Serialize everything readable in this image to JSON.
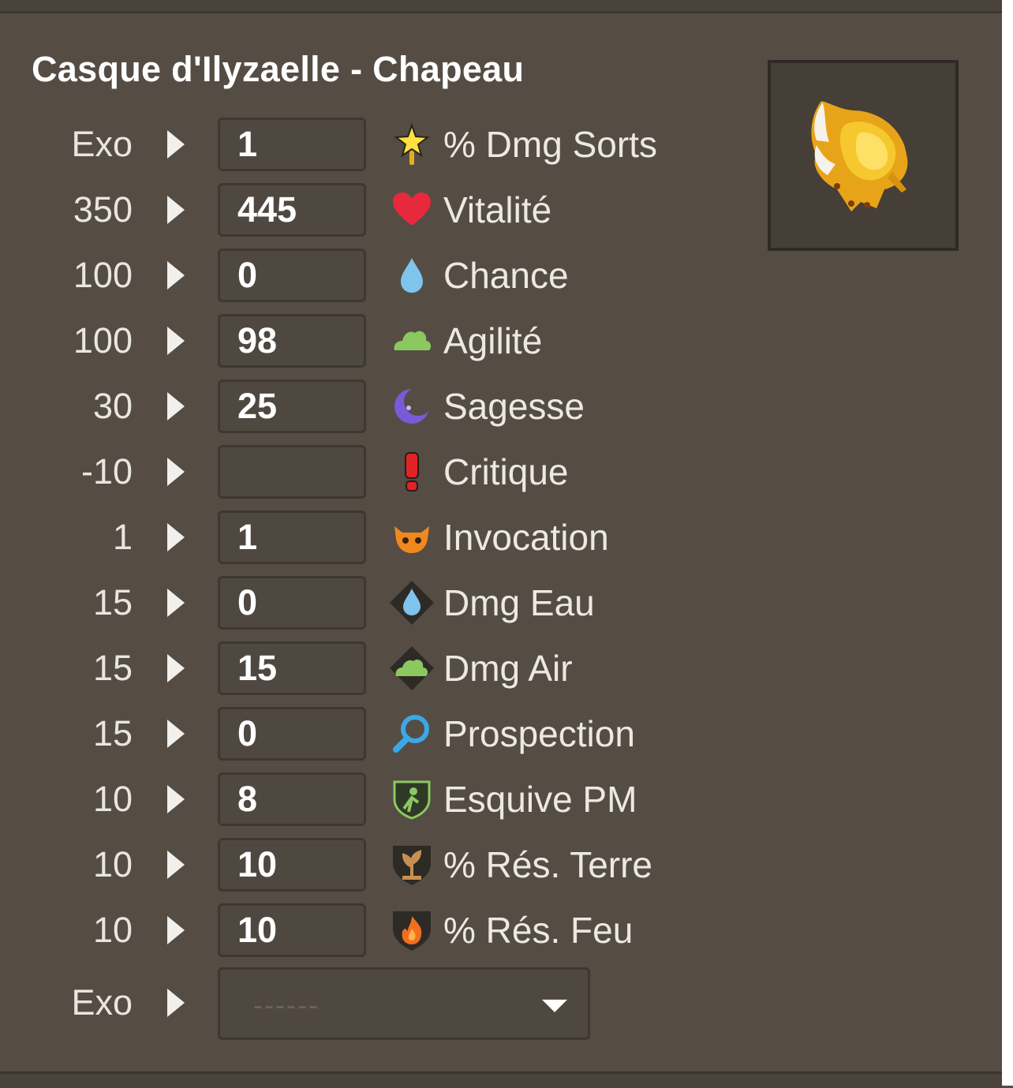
{
  "item": {
    "title": "Casque d'Ilyzaelle - Chapeau",
    "image_icon": "golden-winged-helmet-icon"
  },
  "rows": [
    {
      "base": "Exo",
      "value": "1",
      "label": "% Dmg Sorts",
      "icon": "star-wand-icon"
    },
    {
      "base": "350",
      "value": "445",
      "label": "Vitalité",
      "icon": "heart-icon"
    },
    {
      "base": "100",
      "value": "0",
      "label": "Chance",
      "icon": "water-drop-icon"
    },
    {
      "base": "100",
      "value": "98",
      "label": "Agilité",
      "icon": "cloud-icon"
    },
    {
      "base": "30",
      "value": "25",
      "label": "Sagesse",
      "icon": "moon-icon"
    },
    {
      "base": "-10",
      "value": "",
      "label": "Critique",
      "icon": "exclamation-icon"
    },
    {
      "base": "1",
      "value": "1",
      "label": "Invocation",
      "icon": "monster-head-icon"
    },
    {
      "base": "15",
      "value": "0",
      "label": "Dmg Eau",
      "icon": "water-damage-icon"
    },
    {
      "base": "15",
      "value": "15",
      "label": "Dmg Air",
      "icon": "air-damage-icon"
    },
    {
      "base": "15",
      "value": "0",
      "label": "Prospection",
      "icon": "magnifier-icon"
    },
    {
      "base": "10",
      "value": "8",
      "label": "Esquive PM",
      "icon": "dodge-shield-icon"
    },
    {
      "base": "10",
      "value": "10",
      "label": "% Rés. Terre",
      "icon": "earth-resist-icon"
    },
    {
      "base": "10",
      "value": "10",
      "label": "% Rés. Feu",
      "icon": "fire-resist-icon"
    }
  ],
  "exo_row": {
    "base": "Exo",
    "placeholder": "------",
    "icon": "chevron-down-icon"
  },
  "colors": {
    "background": "#554d44",
    "input_bg": "#4f4840",
    "input_border": "#3e3831",
    "text": "#ffffff"
  }
}
